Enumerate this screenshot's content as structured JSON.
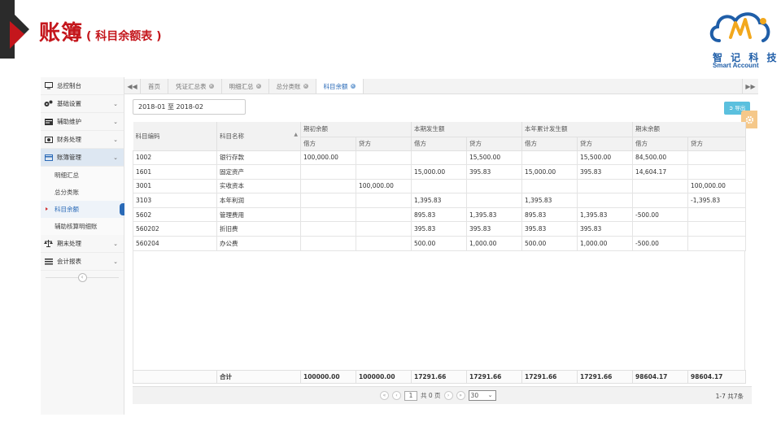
{
  "header": {
    "title": "账簿",
    "subtitle": "( 科目余额表 )",
    "accent_color": "#c4161c"
  },
  "logo": {
    "cn": "智 记 科 技",
    "en": "Smart  Account"
  },
  "sidebar": {
    "items": [
      {
        "label": "总控制台",
        "icon": "monitor-icon"
      },
      {
        "label": "基础设置",
        "icon": "gears-icon"
      },
      {
        "label": "辅助维护",
        "icon": "list-card-icon"
      },
      {
        "label": "财务处理",
        "icon": "money-icon"
      },
      {
        "label": "账簿管理",
        "icon": "card-icon"
      },
      {
        "label": "期末处理",
        "icon": "scale-icon"
      },
      {
        "label": "会计报表",
        "icon": "report-icon"
      }
    ],
    "subitems": [
      "明细汇总",
      "总分类账",
      "科目余额",
      "辅助核算明细账"
    ]
  },
  "tabs": [
    "首页",
    "凭证汇总表",
    "明细汇总",
    "总分类账",
    "科目余额"
  ],
  "filter": {
    "date_range": "2018-01 至 2018-02"
  },
  "export_label": "导出",
  "table": {
    "group_headers": [
      "期初余额",
      "本期发生额",
      "本年累计发生额",
      "期末余额"
    ],
    "col_code": "科目编码",
    "col_name": "科目名称",
    "debit": "借方",
    "credit": "贷方",
    "rows": [
      [
        "1002",
        "银行存款",
        "100,000.00",
        "",
        "",
        "15,500.00",
        "",
        "15,500.00",
        "84,500.00",
        ""
      ],
      [
        "1601",
        "固定资产",
        "",
        "",
        "15,000.00",
        "395.83",
        "15,000.00",
        "395.83",
        "14,604.17",
        ""
      ],
      [
        "3001",
        "实收资本",
        "",
        "100,000.00",
        "",
        "",
        "",
        "",
        "",
        "100,000.00"
      ],
      [
        "3103",
        "本年利润",
        "",
        "",
        "1,395.83",
        "",
        "1,395.83",
        "",
        "",
        "-1,395.83"
      ],
      [
        "5602",
        "管理费用",
        "",
        "",
        "895.83",
        "1,395.83",
        "895.83",
        "1,395.83",
        "-500.00",
        ""
      ],
      [
        "560202",
        "折旧费",
        "",
        "",
        "395.83",
        "395.83",
        "395.83",
        "395.83",
        "",
        ""
      ],
      [
        "560204",
        "办公费",
        "",
        "",
        "500.00",
        "1,000.00",
        "500.00",
        "1,000.00",
        "-500.00",
        ""
      ]
    ],
    "total": [
      "合计",
      "100000.00",
      "100000.00",
      "17291.66",
      "17291.66",
      "17291.66",
      "17291.66",
      "98604.17",
      "98604.17"
    ]
  },
  "pager": {
    "page": "1",
    "total_pages": "共 0 页",
    "page_size": "30",
    "info": "1-7 共7条"
  }
}
